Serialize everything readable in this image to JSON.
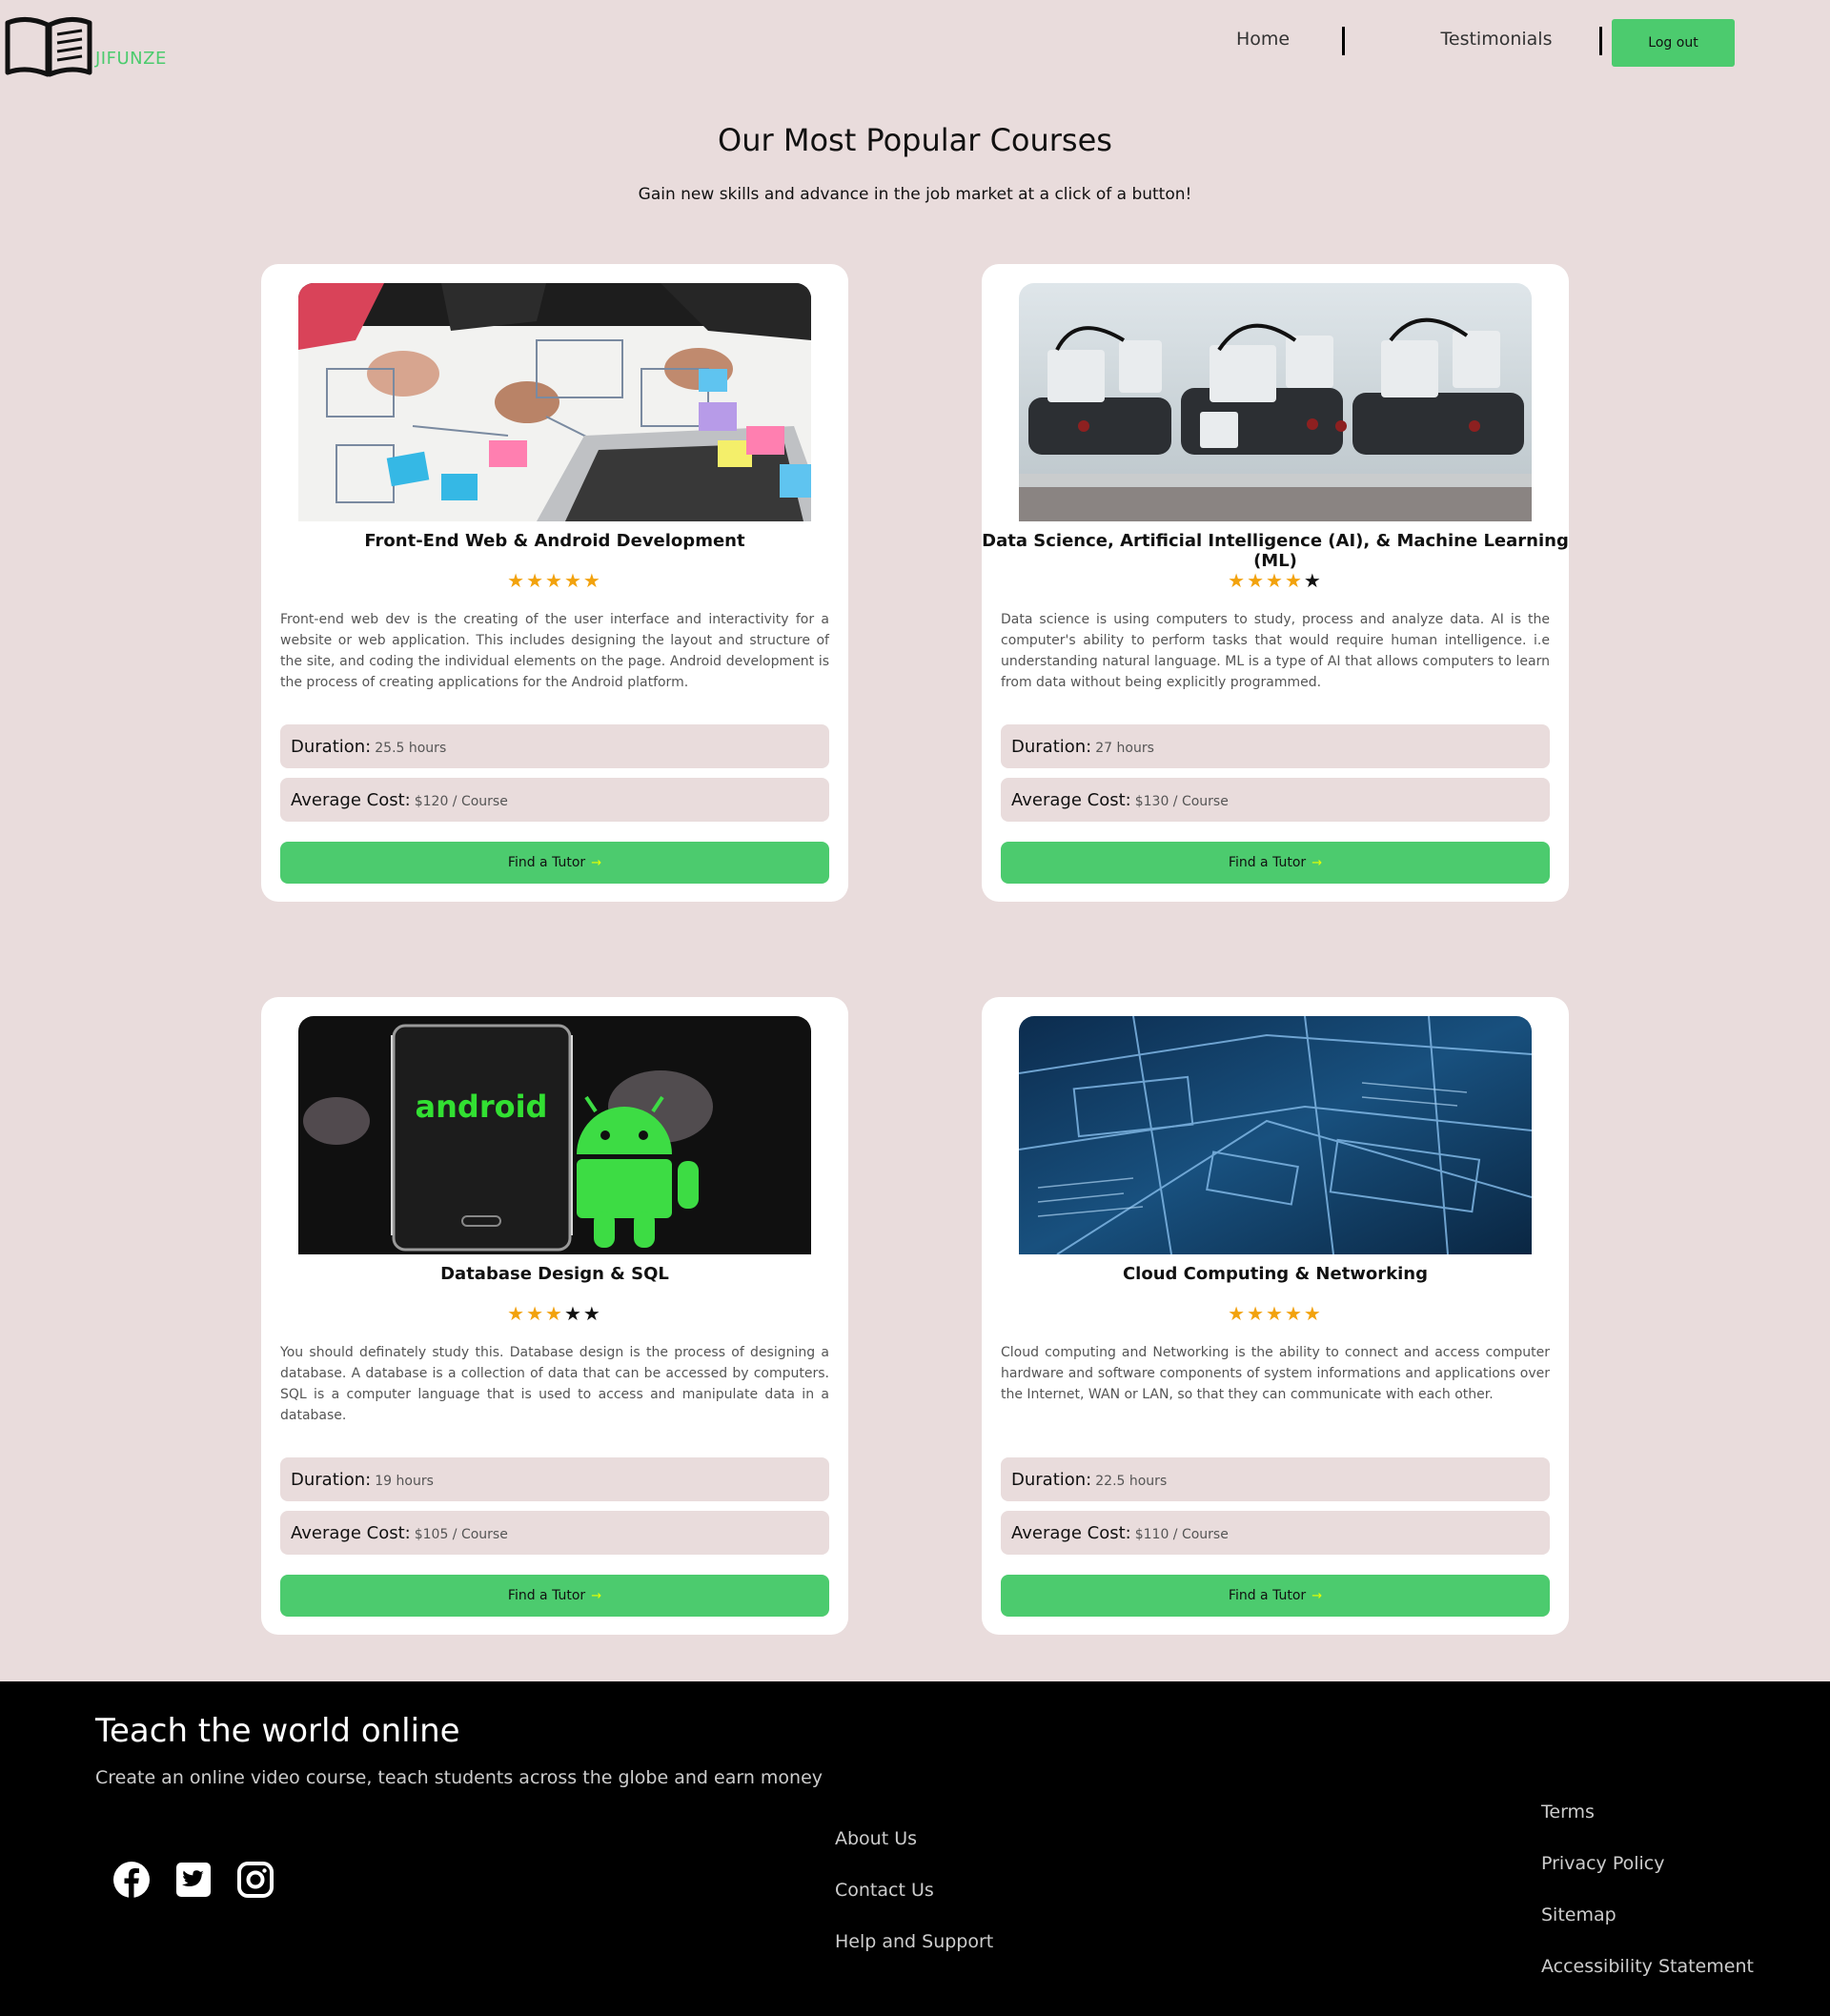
{
  "header": {
    "logo_text": "JIFUNZE",
    "nav": {
      "home": "Home",
      "testimonials": "Testimonials",
      "logout": "Log out"
    }
  },
  "hero": {
    "title": "Our Most Popular Courses",
    "subtitle": "Gain new skills and advance in the job market at a click of a button!"
  },
  "courses": [
    {
      "title": "Front-End Web & Android Development",
      "rating": 5,
      "stars": "★★★★★",
      "description": "Front-end web dev is the creating of the user interface and interactivity for a website or web application. This includes designing the layout and structure of the site, and coding the individual elements on the page. Android development is the process of creating applications for the Android platform.",
      "duration_label": "Duration:",
      "duration_value": "25.5 hours",
      "cost_label": "Average Cost:",
      "cost_value": "$120 / Course",
      "button_label": "Find a Tutor",
      "button_arrow": "→"
    },
    {
      "title": "Data Science, Artificial Intelligence (AI), & Machine Learning (ML)",
      "rating": 4,
      "stars": "★★★★★",
      "description": "Data science is using computers to study, process and analyze data. AI is the computer's ability to perform tasks that would require human intelligence. i.e understanding natural language. ML is a type of AI that allows computers to learn from data without being explicitly programmed.",
      "duration_label": "Duration:",
      "duration_value": "27 hours",
      "cost_label": "Average Cost:",
      "cost_value": "$130 / Course",
      "button_label": "Find a Tutor",
      "button_arrow": "→"
    },
    {
      "title": "Database Design & SQL",
      "rating": 3,
      "stars": "★★★★★",
      "image_text": "android",
      "description": "You should definately study this. Database design is the process of designing a database. A database is a collection of data that can be accessed by computers. SQL is a computer language that is used to access and manipulate data in a database.",
      "duration_label": "Duration:",
      "duration_value": "19 hours",
      "cost_label": "Average Cost:",
      "cost_value": "$105 / Course",
      "button_label": "Find a Tutor",
      "button_arrow": "→"
    },
    {
      "title": "Cloud Computing & Networking",
      "rating": 5,
      "stars": "★★★★★",
      "description": "Cloud computing and Networking is the ability to connect and access computer hardware and software components of system informations and applications over the Internet, WAN or LAN, so that they can communicate with each other.",
      "duration_label": "Duration:",
      "duration_value": "22.5 hours",
      "cost_label": "Average Cost:",
      "cost_value": "$110 / Course",
      "button_label": "Find a Tutor",
      "button_arrow": "→"
    }
  ],
  "footer": {
    "title": "Teach the world online",
    "tagline": "Create an online video course, teach students across the globe and earn money",
    "socials": [
      "facebook-icon",
      "twitter-icon",
      "instagram-icon"
    ],
    "col1": [
      "About Us",
      "Contact Us",
      "Help and Support"
    ],
    "col2": [
      "Terms",
      "Privacy Policy",
      "Sitemap",
      "Accessibility Statement"
    ]
  },
  "colors": {
    "background": "#e9dcdc",
    "accent": "#4ccb6e",
    "star": "#f2a20d",
    "footer": "#000000"
  }
}
